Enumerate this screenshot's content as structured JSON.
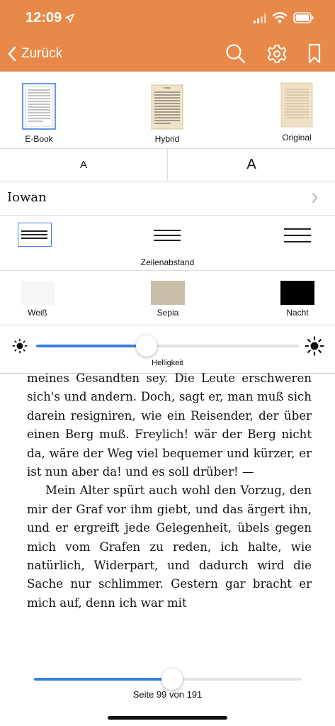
{
  "status_bar": {
    "time": "12:09"
  },
  "header": {
    "back_label": "Zurück",
    "color": "#E8894A",
    "icons": [
      "search-icon",
      "gear-icon",
      "bookmark-icon"
    ]
  },
  "view_modes": [
    {
      "label": "E-Book",
      "selected": true
    },
    {
      "label": "Hybrid",
      "selected": false
    },
    {
      "label": "Original",
      "selected": false
    }
  ],
  "font_size": {
    "smaller_label": "A",
    "larger_label": "A"
  },
  "font_family": {
    "value": "Iowan"
  },
  "line_spacing": {
    "title": "Zeilenabstand",
    "options": [
      "tight",
      "medium",
      "wide"
    ],
    "selected": "tight"
  },
  "color_themes": [
    {
      "label": "Weiß",
      "color": "#F6F6F6"
    },
    {
      "label": "Sepia",
      "color": "#C9BEAA"
    },
    {
      "label": "Nacht",
      "color": "#000000"
    }
  ],
  "brightness": {
    "label": "Helligkeit",
    "value_fraction": 0.42
  },
  "reading_text": {
    "paragraph1": "meines Gesandten sey. Die Leute erschweren sich's und andern. Doch, sagt er, man muß sich darein resigniren, wie ein Reisender, der über einen Berg muß. Freylich! wär der Berg nicht da, wäre der Weg viel bequemer und kürzer, er ist nun aber da! und es soll drüber! —",
    "paragraph2": "Mein Alter spürt auch wohl den Vorzug, den mir der Graf vor ihm giebt, und das ärgert ihn, und er ergreift jede Gelegenheit, übels gegen mich vom Grafen zu reden, ich halte, wie natürlich, Widerpart, und dadurch wird die Sache nur schlimmer. Gestern gar bracht er mich auf, denn ich war mit"
  },
  "page_slider": {
    "label": "Seite 99 von 191",
    "current_page": 99,
    "total_pages": 191
  },
  "accent_color": "#3A7EE4"
}
